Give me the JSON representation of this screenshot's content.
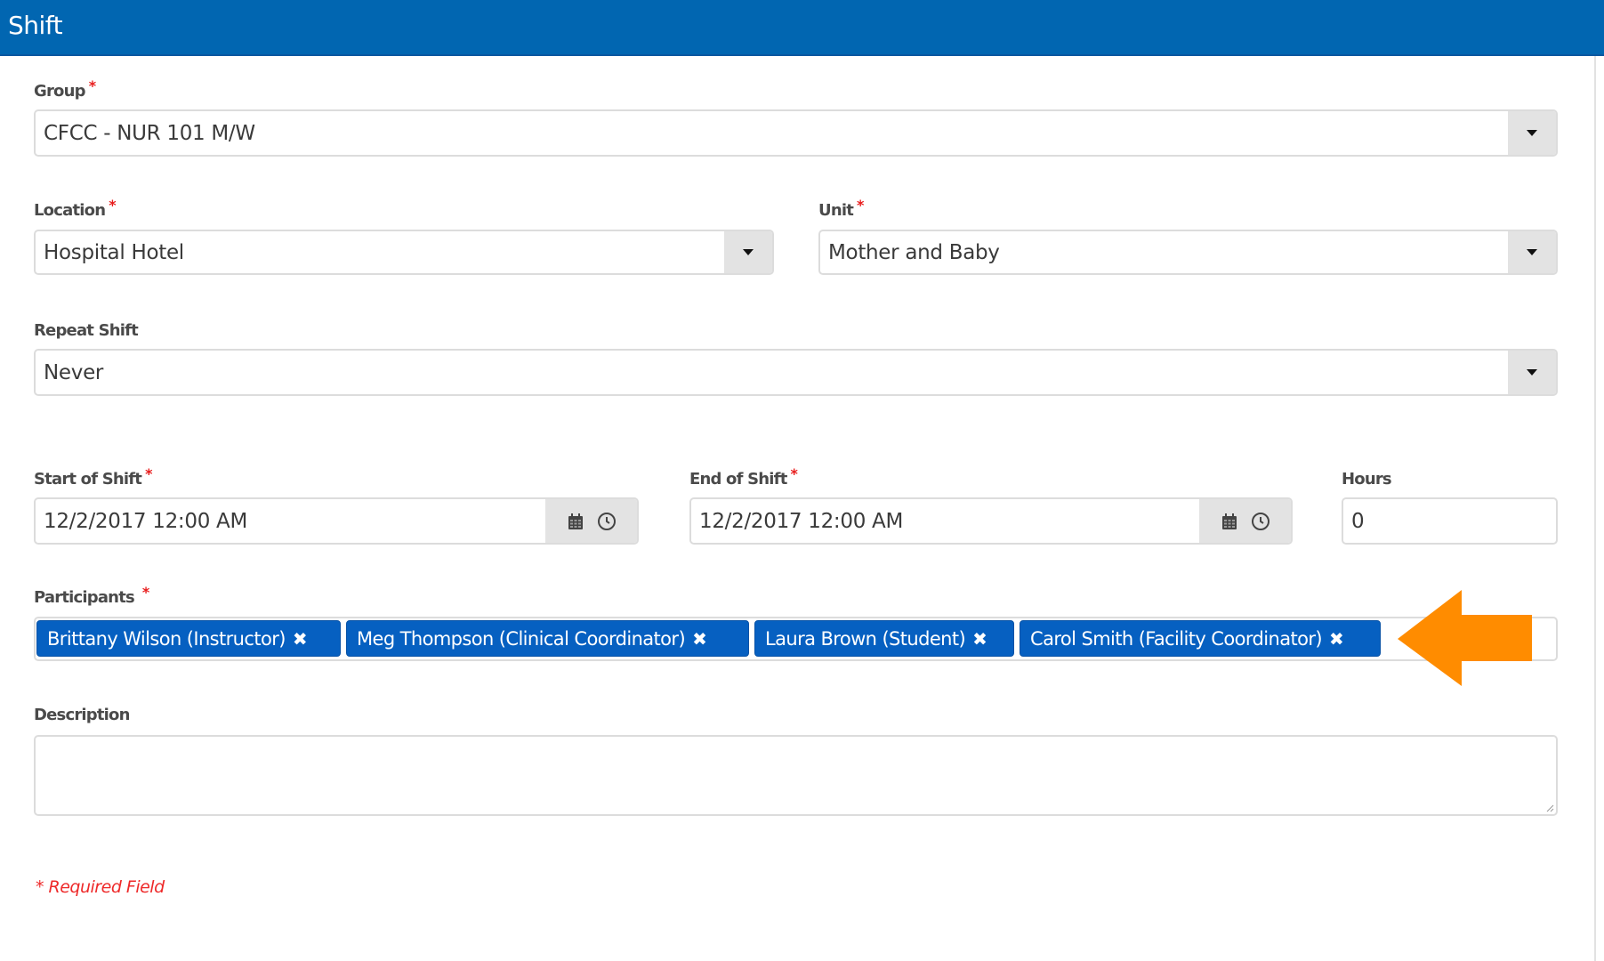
{
  "header": {
    "title": "Shift",
    "color": "#0166b1"
  },
  "form": {
    "group": {
      "label": "Group",
      "required": "*",
      "value": "CFCC - NUR 101 M/W"
    },
    "location": {
      "label": "Location",
      "required": "*",
      "value": "Hospital Hotel"
    },
    "unit": {
      "label": "Unit",
      "required": "*",
      "value": "Mother and Baby"
    },
    "repeat_shift": {
      "label": "Repeat Shift",
      "value": "Never"
    },
    "start_of_shift": {
      "label": "Start of Shift",
      "required": "*",
      "value": "12/2/2017 12:00 AM"
    },
    "end_of_shift": {
      "label": "End of Shift",
      "required": "*",
      "value": "12/2/2017 12:00 AM"
    },
    "hours": {
      "label": "Hours",
      "value": "0"
    },
    "participants": {
      "label": "Participants",
      "required": "*",
      "remove_glyph": "✖",
      "tags": [
        {
          "label": "Brittany Wilson (Instructor)"
        },
        {
          "label": "Meg Thompson (Clinical Coordinator)"
        },
        {
          "label": "Laura Brown (Student)"
        },
        {
          "label": "Carol Smith (Facility Coordinator)"
        }
      ],
      "tag_color": "#0660c1"
    },
    "description": {
      "label": "Description",
      "value": ""
    },
    "required_note": "* Required Field"
  },
  "annotation": {
    "icon": "left-arrow",
    "color": "#ff8c00"
  }
}
